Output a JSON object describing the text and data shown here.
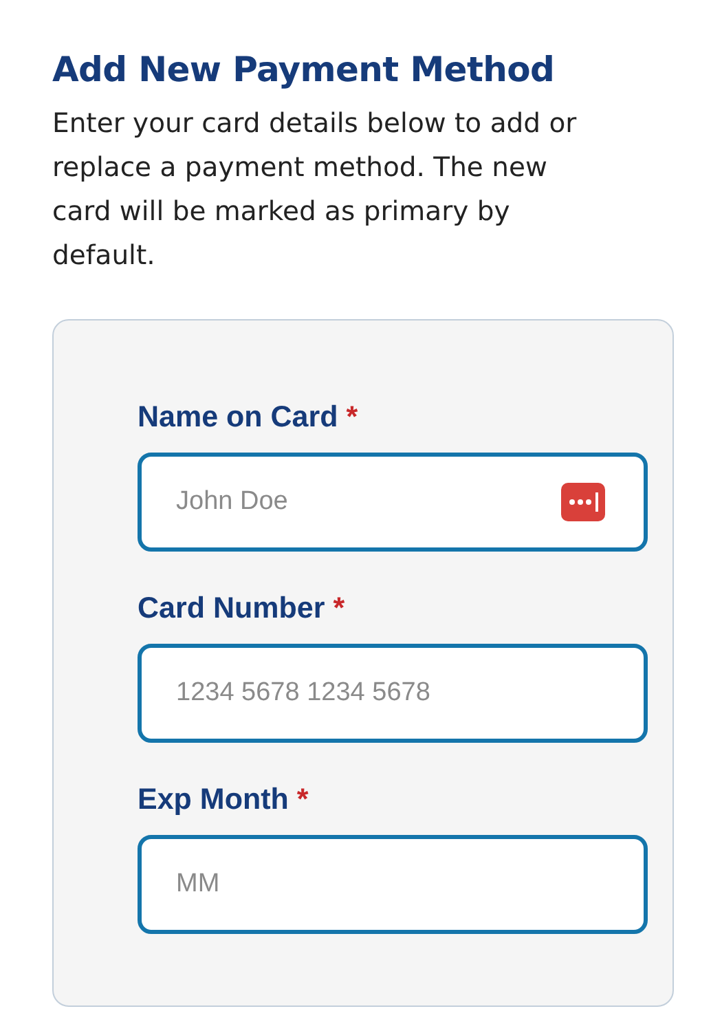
{
  "heading": "Add New Payment Method",
  "description": "Enter your card details below to add or replace a payment method. The new card will be marked as primary by default.",
  "fields": [
    {
      "label": "Name on Card",
      "required_mark": "*",
      "required": true,
      "placeholder": "John Doe",
      "autofill_icon": true
    },
    {
      "label": "Card Number",
      "required_mark": "*",
      "required": true,
      "placeholder": "1234 5678 1234 5678",
      "autofill_icon": false
    },
    {
      "label": "Exp Month",
      "required_mark": "*",
      "required": true,
      "placeholder": "MM",
      "autofill_icon": false
    }
  ]
}
